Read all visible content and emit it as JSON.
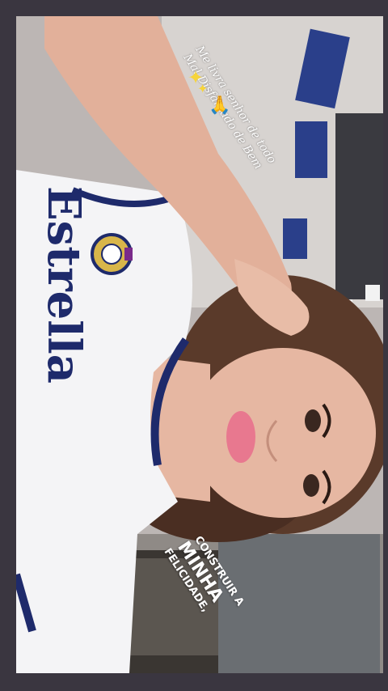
{
  "story": {
    "caption_top": "Me livra senhor de todo Mal Disfarçado de Bem",
    "caption_bottom": [
      "CONSTRUIR A",
      "MINHA",
      "FELICIDADE,"
    ],
    "sticker_icons": [
      "sparkles-icon",
      "praying-hands-icon"
    ]
  },
  "shirt": {
    "lettering": "Estrella"
  },
  "palette": {
    "background": "#3a3640",
    "shirt": "#f4f4f6",
    "trim": "#1e2a6b",
    "lips": "#e8788f",
    "hair": "#5a3a2a"
  }
}
